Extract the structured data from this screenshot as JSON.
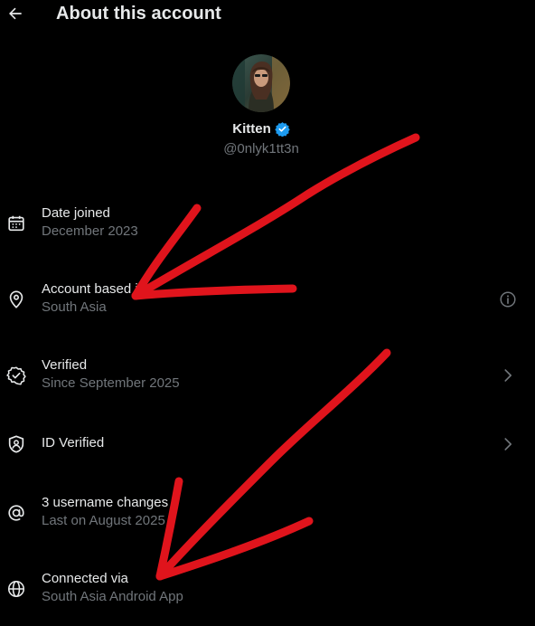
{
  "header": {
    "title": "About this account",
    "back_icon": "back-arrow-icon"
  },
  "profile": {
    "display_name": "Kitten",
    "handle": "@0nlyk1tt3n",
    "verified_color": "#1d9bf0"
  },
  "rows": [
    {
      "label": "Date joined",
      "sub": "December 2023",
      "icon": "calendar-icon"
    },
    {
      "label": "Account based in",
      "sub": "South Asia",
      "icon": "location-pin-icon",
      "trailing": "info-icon"
    },
    {
      "label": "Verified",
      "sub": "Since September 2025",
      "icon": "verified-check-icon",
      "trailing": "chevron-right-icon"
    },
    {
      "label": "ID Verified",
      "sub": "",
      "icon": "id-shield-icon",
      "trailing": "chevron-right-icon"
    },
    {
      "label": "3 username changes",
      "sub": "Last on August 2025",
      "icon": "at-sign-icon"
    },
    {
      "label": "Connected via",
      "sub": "South Asia Android App",
      "icon": "globe-icon"
    }
  ],
  "annotation_color": "#e0141c"
}
